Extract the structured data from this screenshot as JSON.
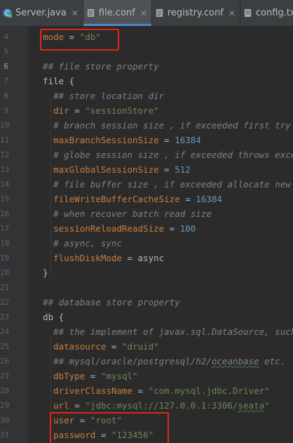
{
  "tabs": [
    {
      "label": "Server.java",
      "icon": "java-class-icon",
      "active": false
    },
    {
      "label": "file.conf",
      "icon": "config-file-icon",
      "active": true
    },
    {
      "label": "registry.conf",
      "icon": "config-file-icon",
      "active": false
    },
    {
      "label": "config.txt",
      "icon": "text-file-icon",
      "active": false
    }
  ],
  "line_numbers": [
    "4",
    "5",
    "6",
    "7",
    "8",
    "9",
    "10",
    "11",
    "12",
    "13",
    "14",
    "15",
    "16",
    "17",
    "18",
    "19",
    "20",
    "21",
    "22",
    "23",
    "24",
    "25",
    "26",
    "27",
    "28",
    "29",
    "30",
    "31"
  ],
  "lines": [
    {
      "n": "4",
      "tokens": [
        [
          "  mode",
          "key"
        ],
        [
          " = ",
          "plain"
        ],
        [
          "\"db\"",
          "str"
        ]
      ]
    },
    {
      "n": "5",
      "tokens": []
    },
    {
      "n": "6",
      "tokens": [
        [
          "  ## file store property",
          "comment"
        ]
      ]
    },
    {
      "n": "7",
      "tokens": [
        [
          "  file {",
          "plain"
        ]
      ]
    },
    {
      "n": "8",
      "tokens": [
        [
          "    ## store location dir",
          "comment"
        ]
      ]
    },
    {
      "n": "9",
      "tokens": [
        [
          "    dir",
          "key"
        ],
        [
          " = ",
          "plain"
        ],
        [
          "\"sessionStore\"",
          "str"
        ]
      ]
    },
    {
      "n": "10",
      "tokens": [
        [
          "    # branch session size , if exceeded first try compress lockkey, still exceeded throws exceptions",
          "comment"
        ]
      ]
    },
    {
      "n": "11",
      "tokens": [
        [
          "    maxBranchSessionSize",
          "key"
        ],
        [
          " = ",
          "plain"
        ],
        [
          "16384",
          "num"
        ]
      ]
    },
    {
      "n": "12",
      "tokens": [
        [
          "    # globe session size , if exceeded throws exceptions",
          "comment"
        ]
      ]
    },
    {
      "n": "13",
      "tokens": [
        [
          "    maxGlobalSessionSize",
          "key"
        ],
        [
          " = ",
          "plain"
        ],
        [
          "512",
          "num"
        ]
      ]
    },
    {
      "n": "14",
      "tokens": [
        [
          "    # file buffer size , if exceeded allocate new buffer",
          "comment"
        ]
      ]
    },
    {
      "n": "15",
      "tokens": [
        [
          "    fileWriteBufferCacheSize",
          "key"
        ],
        [
          " = ",
          "plain"
        ],
        [
          "16384",
          "num"
        ]
      ]
    },
    {
      "n": "16",
      "tokens": [
        [
          "    # when recover batch read size",
          "comment"
        ]
      ]
    },
    {
      "n": "17",
      "tokens": [
        [
          "    sessionReloadReadSize",
          "key"
        ],
        [
          " = ",
          "plain"
        ],
        [
          "100",
          "num"
        ]
      ]
    },
    {
      "n": "18",
      "tokens": [
        [
          "    # async, sync",
          "comment"
        ]
      ]
    },
    {
      "n": "19",
      "tokens": [
        [
          "    flushDiskMode",
          "key"
        ],
        [
          " = ",
          "plain"
        ],
        [
          "async",
          "plain"
        ]
      ]
    },
    {
      "n": "20",
      "tokens": [
        [
          "  }",
          "plain"
        ]
      ]
    },
    {
      "n": "21",
      "tokens": []
    },
    {
      "n": "22",
      "tokens": [
        [
          "  ## database store property",
          "comment"
        ]
      ]
    },
    {
      "n": "23",
      "tokens": [
        [
          "  db {",
          "plain"
        ]
      ]
    },
    {
      "n": "24",
      "tokens": [
        [
          "    ## the implement of javax.sql.DataSource, such as DruidDataSource(druid)/BasicDataSource(dbcp) etc.",
          "comment"
        ]
      ]
    },
    {
      "n": "25",
      "tokens": [
        [
          "    datasource",
          "key"
        ],
        [
          " = ",
          "plain"
        ],
        [
          "\"druid\"",
          "str"
        ]
      ]
    },
    {
      "n": "26",
      "tokens": [
        [
          "    ## mysql/oracle/postgresql/h2/",
          "comment"
        ],
        [
          "oceanbase",
          "comment under"
        ],
        [
          " etc.",
          "comment"
        ]
      ]
    },
    {
      "n": "27",
      "tokens": [
        [
          "    dbType",
          "key"
        ],
        [
          " = ",
          "plain"
        ],
        [
          "\"mysql\"",
          "str"
        ]
      ]
    },
    {
      "n": "28",
      "tokens": [
        [
          "    driverClassName",
          "key"
        ],
        [
          " = ",
          "plain"
        ],
        [
          "\"com.mysql.jdbc.Driver\"",
          "str"
        ]
      ]
    },
    {
      "n": "29",
      "tokens": [
        [
          "    url",
          "key"
        ],
        [
          " = ",
          "plain"
        ],
        [
          "\"jdbc:mysql://127.0.0.1:3306/",
          "str"
        ],
        [
          "seata",
          "str under"
        ],
        [
          "\"",
          "str"
        ]
      ]
    },
    {
      "n": "30",
      "tokens": [
        [
          "    user",
          "key"
        ],
        [
          " = ",
          "plain"
        ],
        [
          "\"root\"",
          "str"
        ]
      ]
    },
    {
      "n": "31",
      "tokens": [
        [
          "    password",
          "key"
        ],
        [
          " = ",
          "plain"
        ],
        [
          "\"123456\"",
          "str"
        ]
      ]
    }
  ],
  "highlighted_line_numbers": [
    "6"
  ],
  "colors": {
    "keyword": "#c77d3f",
    "string": "#6a8759",
    "number": "#6897bb",
    "comment": "#808080",
    "highlight_box": "#e0261b",
    "active_tab_underline": "#4a88c7"
  }
}
